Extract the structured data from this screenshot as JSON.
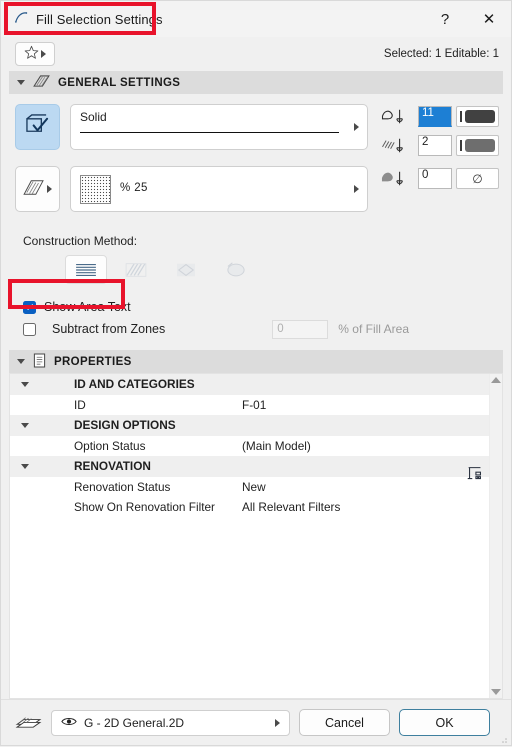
{
  "window": {
    "title": "Fill Selection Settings",
    "help_label": "?",
    "close_label": "✕"
  },
  "favorites": {
    "button_name": "favorites",
    "selection_info": "Selected: 1 Editable: 1"
  },
  "general_settings": {
    "header": "GENERAL SETTINGS",
    "fill_type_combo": {
      "label": "Solid"
    },
    "fill_pattern_combo": {
      "label": "% 25"
    },
    "pens": [
      {
        "name": "contour-pen",
        "value": "11",
        "swatch_color": "#414141",
        "selected": true,
        "swatch_kind": "color"
      },
      {
        "name": "fill-pen",
        "value": "2",
        "swatch_color": "#6e6e6e",
        "selected": false,
        "swatch_kind": "color"
      },
      {
        "name": "background-pen",
        "value": "0",
        "swatch_color": "",
        "selected": false,
        "swatch_kind": "none"
      }
    ]
  },
  "construction_method": {
    "label": "Construction Method:",
    "options": [
      {
        "name": "linear-fill",
        "active": true,
        "disabled": false
      },
      {
        "name": "directional-fill",
        "active": false,
        "disabled": true
      },
      {
        "name": "radial-fill",
        "active": false,
        "disabled": true
      },
      {
        "name": "distorted-fill",
        "active": false,
        "disabled": true
      }
    ]
  },
  "checkboxes": {
    "show_area_text": {
      "label": "Show Area Text",
      "checked": true
    },
    "subtract_from_zones": {
      "label": "Subtract from Zones",
      "checked": false
    },
    "percent_value": "0",
    "percent_label": "% of Fill Area"
  },
  "properties": {
    "header": "PROPERTIES",
    "rows": [
      {
        "type": "group",
        "name": "ID AND CATEGORIES",
        "value": ""
      },
      {
        "type": "item",
        "name": "ID",
        "value": "F-01"
      },
      {
        "type": "group",
        "name": "DESIGN OPTIONS",
        "value": ""
      },
      {
        "type": "item",
        "name": "Option Status",
        "value": "(Main Model)"
      },
      {
        "type": "group",
        "name": "RENOVATION",
        "value": ""
      },
      {
        "type": "item",
        "name": "Renovation Status",
        "value": "New"
      },
      {
        "type": "item",
        "name": "Show On Renovation Filter",
        "value": "All Relevant Filters"
      }
    ]
  },
  "bottom_bar": {
    "layer_label": "G - 2D General.2D",
    "cancel_label": "Cancel",
    "ok_label": "OK"
  },
  "annotations": {
    "accent_red": "#e8132b"
  }
}
